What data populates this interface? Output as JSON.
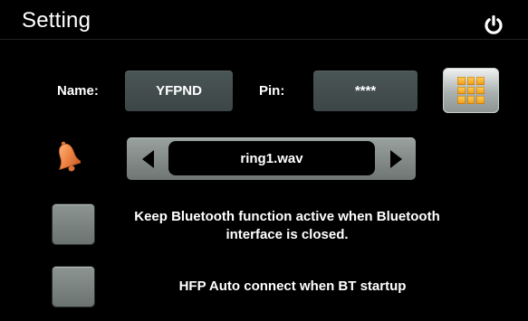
{
  "header": {
    "title": "Setting",
    "power_icon": "power-icon"
  },
  "device": {
    "name_label": "Name:",
    "name_value": "YFPND",
    "pin_label": "Pin:",
    "pin_value": "****",
    "keypad_icon": "keypad-grid-icon"
  },
  "ringtone": {
    "bell_icon": "bell-icon",
    "prev_icon": "left-arrow-icon",
    "next_icon": "right-arrow-icon",
    "value": "ring1.wav"
  },
  "options": {
    "keep_active_line1": "Keep Bluetooth function active when Bluetooth",
    "keep_active_line2": "interface is closed.",
    "hfp_auto": "HFP Auto connect when BT startup"
  },
  "colors": {
    "background": "#000000",
    "field": "#3d4647",
    "accent_orange": "#f29a12"
  }
}
